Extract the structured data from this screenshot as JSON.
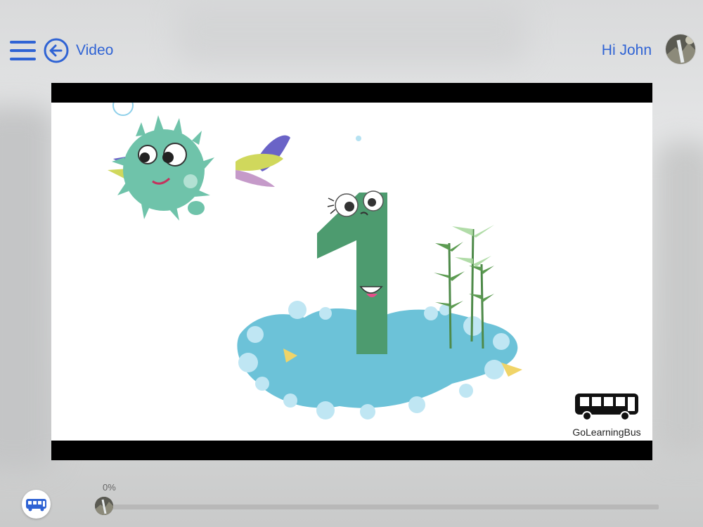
{
  "header": {
    "title": "Video",
    "greeting": "Hi John"
  },
  "icons": {
    "menu": "hamburger-menu-icon",
    "back": "back-arrow-icon",
    "avatar": "user-avatar",
    "bus": "bus-icon"
  },
  "video": {
    "watermark": "GoLearningBus",
    "progress_text": "0%",
    "progress_value": 0
  },
  "colors": {
    "accent": "#2f63d4",
    "progress_track": "#b8b8b8",
    "progress_fill": "#e6506a"
  }
}
